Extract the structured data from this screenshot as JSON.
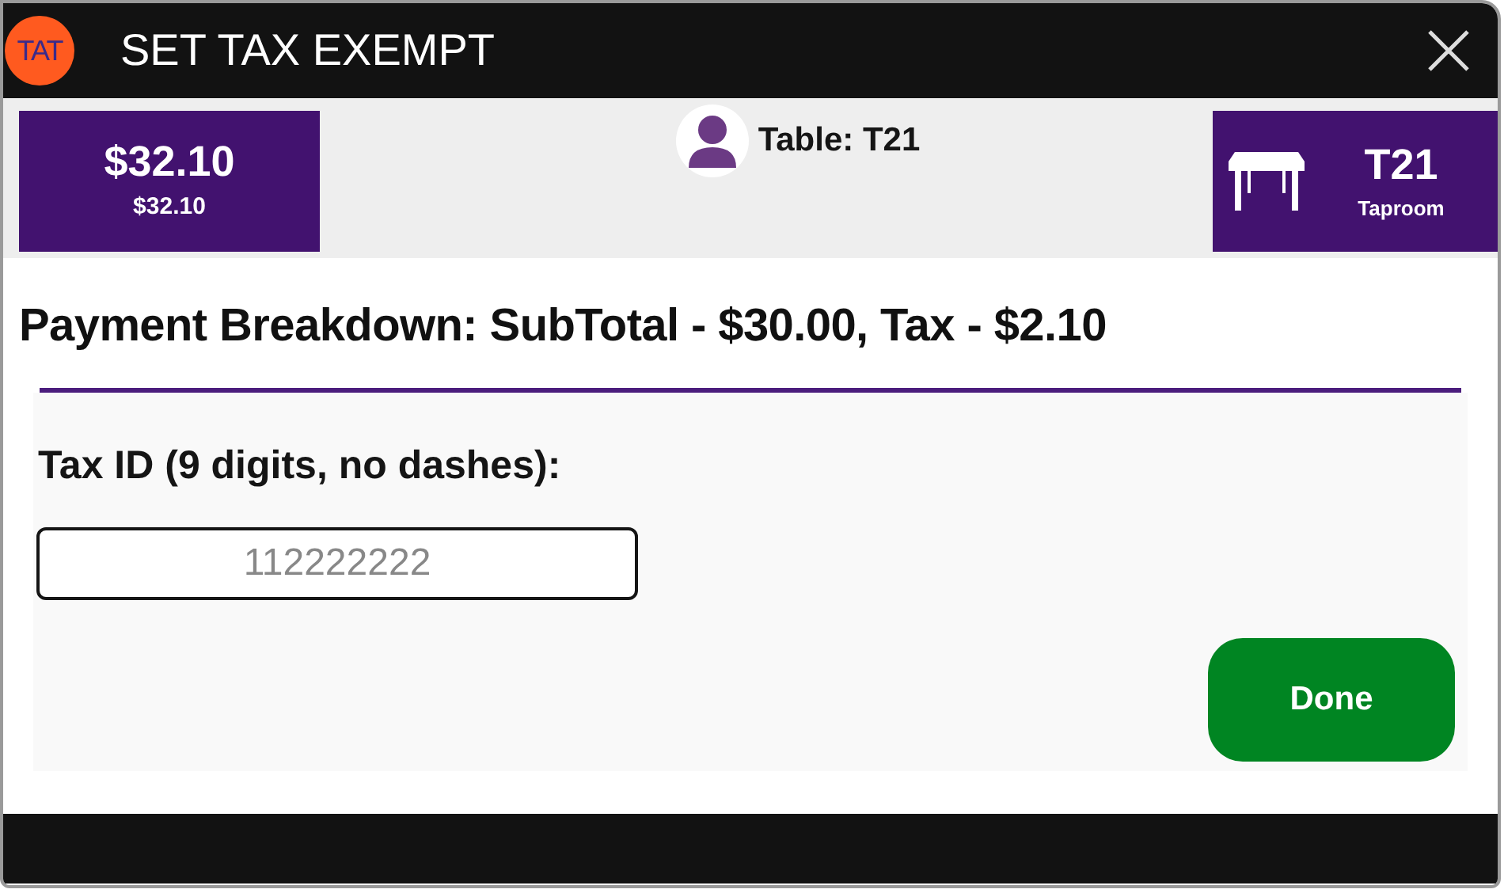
{
  "window": {
    "logo_text": "TAT",
    "title": "SET TAX EXEMPT"
  },
  "header": {
    "total": {
      "amount": "$32.10",
      "subtotal": "$32.10"
    },
    "table_label": "Table: T21",
    "table_card": {
      "name": "T21",
      "area": "Taproom"
    }
  },
  "breakdown": "Payment Breakdown: SubTotal - $30.00, Tax - $2.10",
  "form": {
    "label": "Tax ID (9 digits, no dashes):",
    "field": {
      "placeholder": "112222222"
    },
    "button": "Done"
  }
}
